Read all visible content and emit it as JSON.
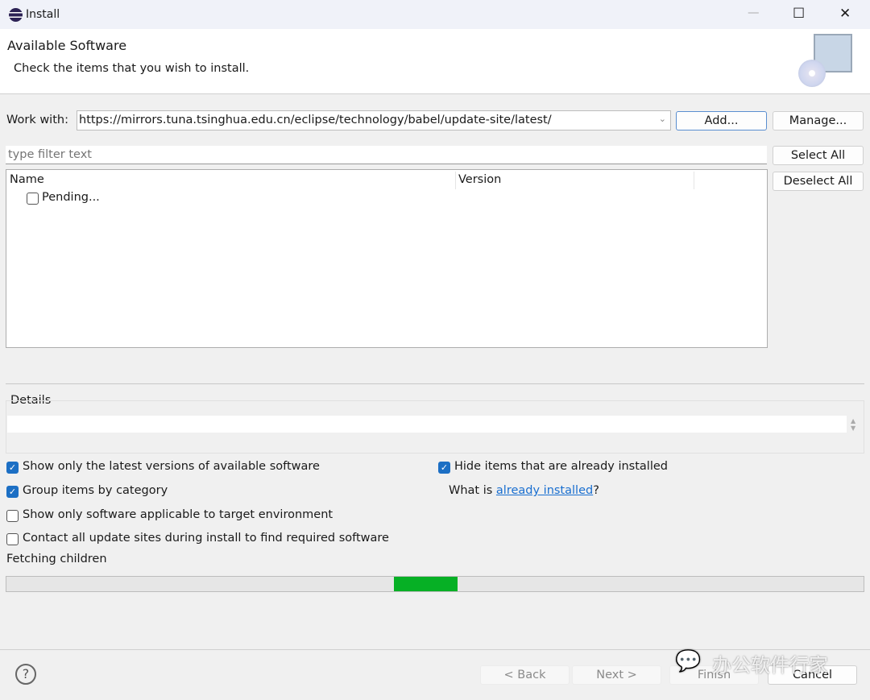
{
  "window": {
    "title": "Install",
    "controls": {
      "minimize": "—",
      "maximize": "☐",
      "close": "✕"
    }
  },
  "banner": {
    "title": "Available Software",
    "subtitle": "Check the items that you wish to install."
  },
  "work_with": {
    "label": "Work with:",
    "value": "https://mirrors.tuna.tsinghua.edu.cn/eclipse/technology/babel/update-site/latest/",
    "add": "Add...",
    "manage": "Manage..."
  },
  "filter": {
    "placeholder": "type filter text",
    "select_all": "Select All",
    "deselect_all": "Deselect All"
  },
  "table": {
    "columns": [
      "Name",
      "Version"
    ],
    "rows": [
      {
        "name": "Pending...",
        "checked": false
      }
    ]
  },
  "details": {
    "label": "Details"
  },
  "options": {
    "latest": {
      "label": "Show only the latest versions of available software",
      "checked": true
    },
    "group": {
      "label": "Group items by category",
      "checked": true
    },
    "applicable": {
      "label": "Show only software applicable to target environment",
      "checked": false
    },
    "contact": {
      "label": "Contact all update sites during install to find required software",
      "checked": false
    },
    "hide": {
      "label": "Hide items that are already installed",
      "checked": true
    },
    "what_is": "What is ",
    "link": "already installed",
    "qmark": "?"
  },
  "status": {
    "text": "Fetching children",
    "progress_color": "#06b025"
  },
  "footer": {
    "back": "< Back",
    "next": "Next >",
    "finish": "Finish",
    "cancel": "Cancel",
    "help": "?"
  },
  "watermark": "办公软件行家"
}
